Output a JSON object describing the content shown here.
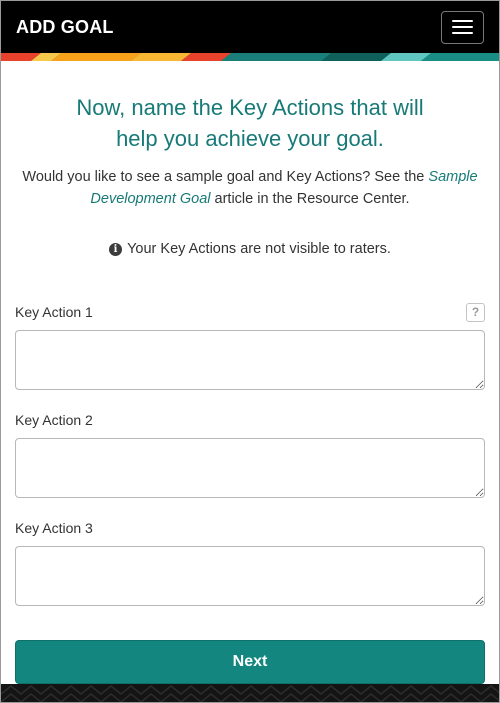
{
  "header": {
    "title": "ADD GOAL",
    "menu_icon": "hamburger-menu-icon"
  },
  "colors": {
    "header_bg": "#000000",
    "accent": "#177a77",
    "button_bg": "#13877f",
    "stripe": [
      "#e8412c",
      "#f6a31b",
      "#1a7f79",
      "#5fc7c0"
    ]
  },
  "main": {
    "heading": "Now, name the Key Actions that will help you achieve your goal.",
    "intro_before": "Would you like to see a sample goal and Key Actions? See the ",
    "intro_link": "Sample Development Goal",
    "intro_after": " article in the Resource Center.",
    "notice": "Your Key Actions are not visible to raters.",
    "notice_icon": "info-icon"
  },
  "form": {
    "fields": [
      {
        "label": "Key Action 1",
        "value": "",
        "help": "?"
      },
      {
        "label": "Key Action 2",
        "value": ""
      },
      {
        "label": "Key Action 3",
        "value": ""
      }
    ],
    "submit_label": "Next"
  }
}
